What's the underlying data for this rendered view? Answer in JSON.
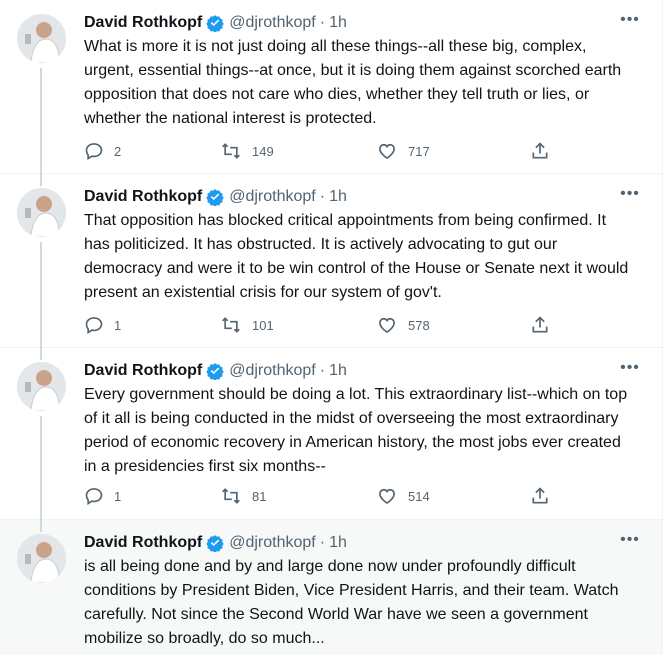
{
  "tweets": [
    {
      "author_name": "David Rothkopf",
      "handle": "@djrothkopf",
      "separator": "·",
      "time": "1h",
      "text": "What is more it is not just doing all these things--all these big, complex, urgent, essential things--at once, but it is doing them against scorched earth opposition that does not care who dies, whether they tell truth or lies, or whether the national interest is protected.",
      "replies": "2",
      "retweets": "149",
      "likes": "717"
    },
    {
      "author_name": "David Rothkopf",
      "handle": "@djrothkopf",
      "separator": "·",
      "time": "1h",
      "text": "That opposition has blocked critical appointments from being confirmed. It has politicized. It has obstructed. It is actively advocating to gut our democracy and were it to be win control of the House or Senate next it would present an existential crisis for our system of gov't.",
      "replies": "1",
      "retweets": "101",
      "likes": "578"
    },
    {
      "author_name": "David Rothkopf",
      "handle": "@djrothkopf",
      "separator": "·",
      "time": "1h",
      "text": "Every government should be doing a lot. This extraordinary list--which on top of it all is being conducted in the midst of overseeing the most extraordinary period of economic recovery in American history, the most jobs ever created in a presidencies first six months--",
      "replies": "1",
      "retweets": "81",
      "likes": "514"
    },
    {
      "author_name": "David Rothkopf",
      "handle": "@djrothkopf",
      "separator": "·",
      "time": "1h",
      "text": "is all being done and by and large done now under profoundly difficult conditions by President Biden, Vice President Harris, and their team. Watch carefully. Not since the Second World War have we seen a government mobilize so broadly, do so much..."
    }
  ],
  "icons": {
    "verified": "verified-badge-icon",
    "more": "more-options-icon",
    "reply": "reply-icon",
    "retweet": "retweet-icon",
    "like": "heart-icon",
    "share": "share-icon"
  },
  "colors": {
    "text": "#0f1419",
    "secondary": "#536471",
    "verified": "#1d9bf0",
    "divider": "#eff3f4",
    "thread_line": "#cfd9de",
    "highlight_bg": "#f7f9f9"
  },
  "more_glyph": "•••"
}
